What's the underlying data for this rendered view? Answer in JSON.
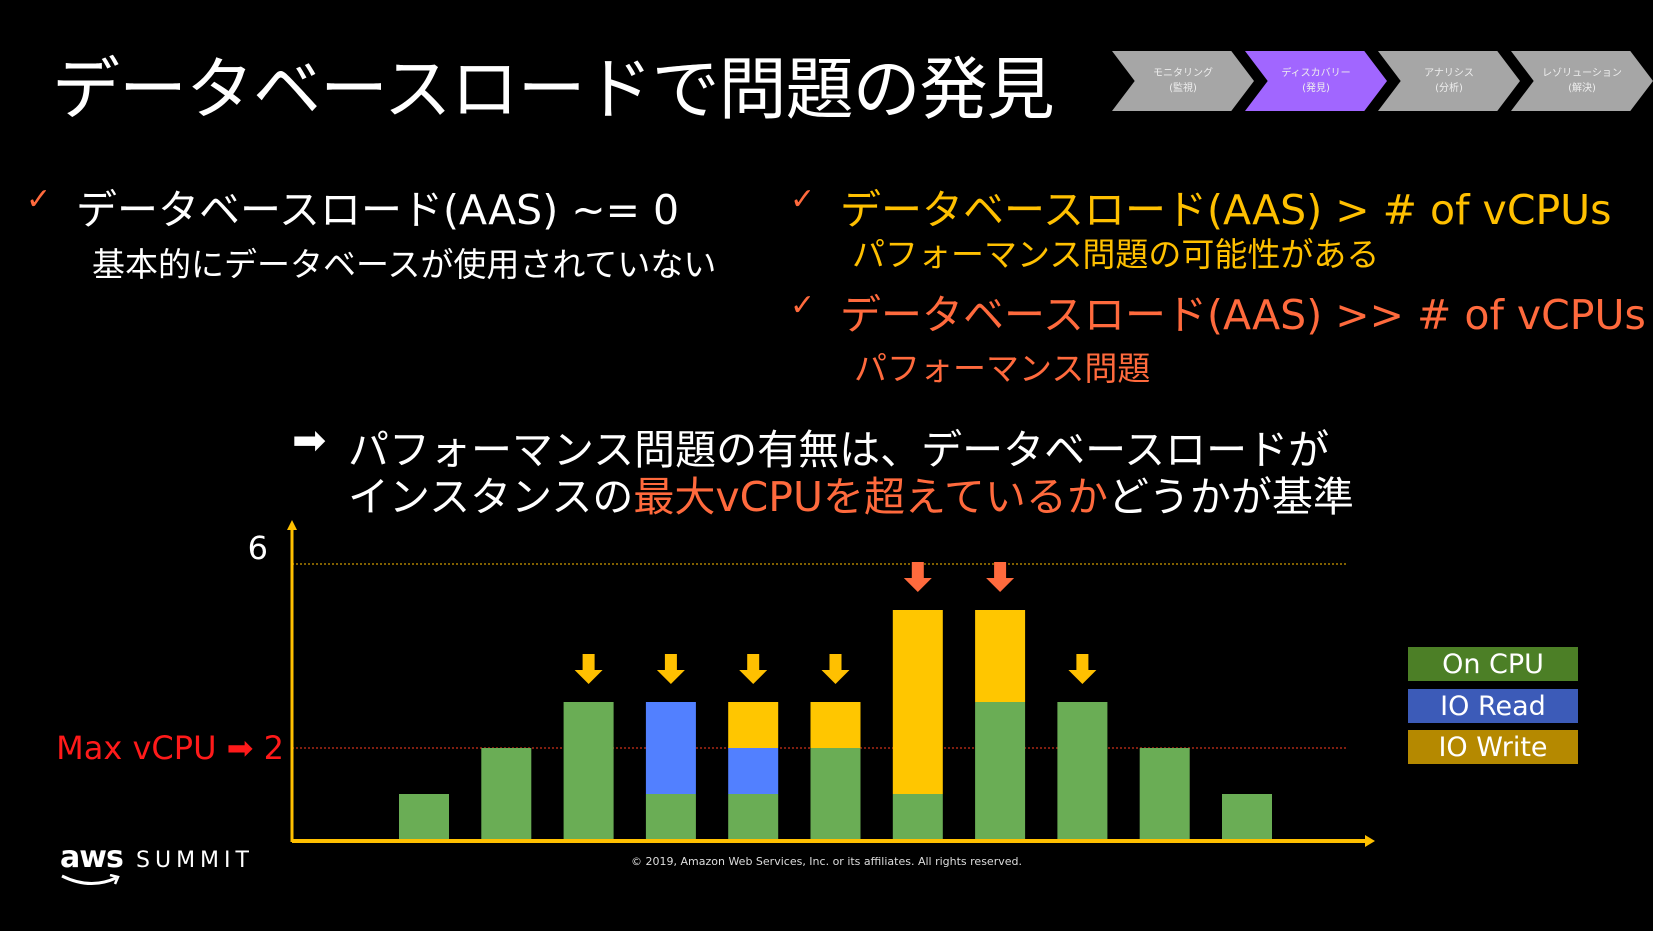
{
  "title": "データベースロードで問題の発見",
  "steps": [
    {
      "label": "モニタリング",
      "sub": "(監視)",
      "active": false
    },
    {
      "label": "ディスカバリー",
      "sub": "(発見)",
      "active": true
    },
    {
      "label": "アナリシス",
      "sub": "(分析)",
      "active": false
    },
    {
      "label": "レゾリューション",
      "sub": "(解決)",
      "active": false
    }
  ],
  "colors": {
    "step": "#A6A6A6",
    "step_active": "#A166FF",
    "on_cpu": "#6AAD55",
    "io_read": "#5280FF",
    "io_write": "#FFC600",
    "warn": "#FFC000",
    "alert": "#FF6A3D",
    "max_line": "#FF3B1F",
    "axis": "#FFC000"
  },
  "bullets": {
    "check": "✓",
    "left": {
      "main": "データベースロード(AAS) ~= 0",
      "sub": "基本的にデータベースが使用されていない"
    },
    "right1": {
      "main": "データベースロード(AAS) > # of vCPUs",
      "sub": "パフォーマンス問題の可能性がある"
    },
    "right2": {
      "main": "データベースロード(AAS) >> # of vCPUs",
      "sub": "パフォーマンス問題"
    }
  },
  "conclusion": {
    "arrow": "➡",
    "line1": "パフォーマンス問題の有無は、データベースロードが",
    "line2_a": "インスタンスの",
    "line2_b": "最大vCPUを超えているか",
    "line2_c": "どうかが基準"
  },
  "chart_data": {
    "type": "bar",
    "stacked": true,
    "ylim": [
      0,
      6.5
    ],
    "yticks": [
      {
        "value": 6,
        "label": "6"
      }
    ],
    "max_vcpu": {
      "value": 2,
      "label": "Max vCPU ➡ 2"
    },
    "series": [
      {
        "name": "On CPU",
        "values": [
          1,
          2,
          3,
          1,
          1,
          2,
          1,
          3,
          3,
          2,
          1
        ]
      },
      {
        "name": "IO Read",
        "values": [
          0,
          0,
          0,
          2,
          1,
          0,
          0,
          0,
          0,
          0,
          0
        ]
      },
      {
        "name": "IO Write",
        "values": [
          0,
          0,
          0,
          0,
          1,
          1,
          4,
          2,
          0,
          0,
          0
        ]
      }
    ],
    "markers": [
      "none",
      "none",
      "warn",
      "warn",
      "warn",
      "warn",
      "alert",
      "alert",
      "warn",
      "none",
      "none"
    ],
    "legend": "right"
  },
  "footer": {
    "brand": "aws",
    "event": "SUMMIT",
    "copyright": "© 2019, Amazon Web Services, Inc. or its affiliates. All rights reserved."
  }
}
